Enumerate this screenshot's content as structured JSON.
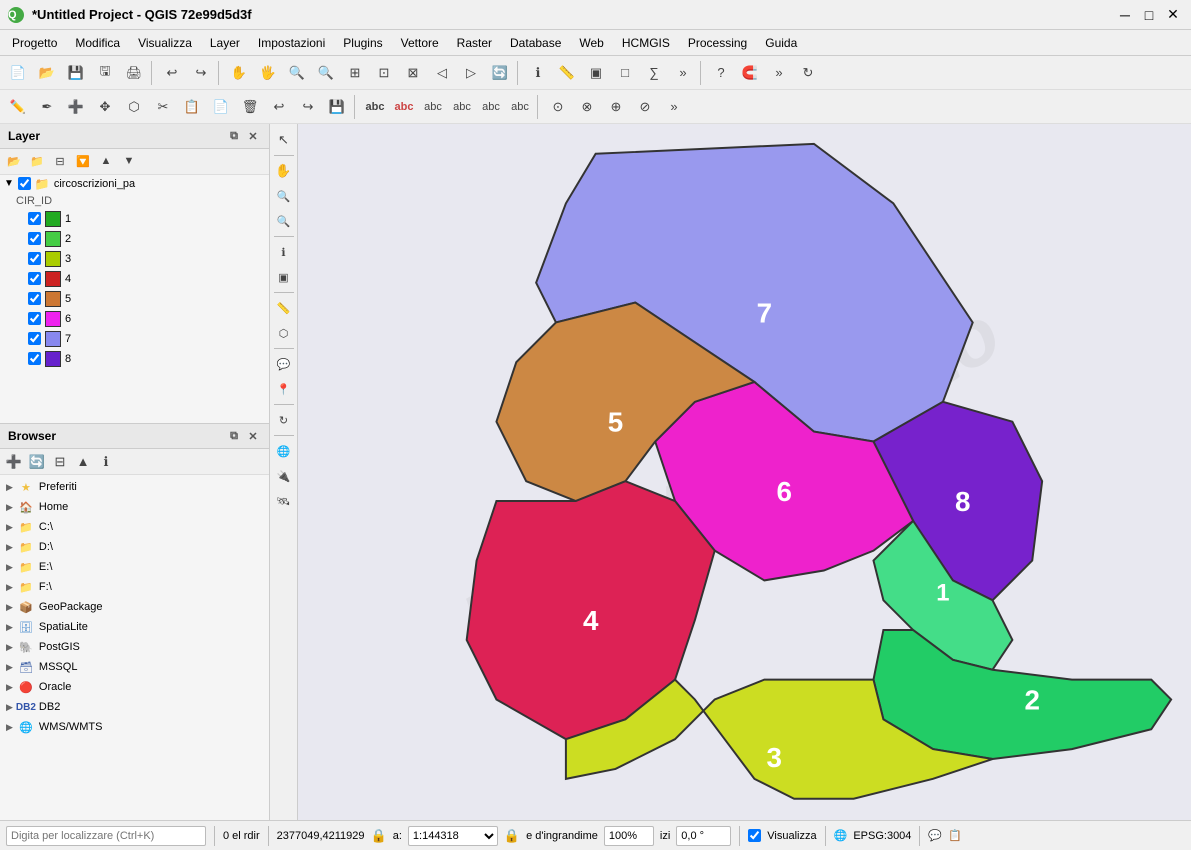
{
  "titlebar": {
    "title": "*Untitled Project - QGIS 72e99d5d3f",
    "icon": "Q"
  },
  "menubar": {
    "items": [
      "Progetto",
      "Modifica",
      "Visualizza",
      "Layer",
      "Impostazioni",
      "Plugins",
      "Vettore",
      "Raster",
      "Database",
      "Web",
      "HCMGIS",
      "Processing",
      "Guida"
    ]
  },
  "layer_panel": {
    "title": "Layer",
    "layer_name": "circoscrizioni_pa",
    "field": "CIR_ID",
    "items": [
      {
        "id": 1,
        "color": "#22aa22",
        "checked": true
      },
      {
        "id": 2,
        "color": "#44cc44",
        "checked": true
      },
      {
        "id": 3,
        "color": "#aacc00",
        "checked": true
      },
      {
        "id": 4,
        "color": "#cc2222",
        "checked": true
      },
      {
        "id": 5,
        "color": "#cc7733",
        "checked": true
      },
      {
        "id": 6,
        "color": "#ee22ee",
        "checked": true
      },
      {
        "id": 7,
        "color": "#8888ee",
        "checked": true
      },
      {
        "id": 8,
        "color": "#6622cc",
        "checked": true
      }
    ]
  },
  "browser_panel": {
    "title": "Browser",
    "items": [
      {
        "label": "Preferiti",
        "icon": "star",
        "type": "favorites"
      },
      {
        "label": "Home",
        "icon": "home",
        "type": "folder"
      },
      {
        "label": "C:\\",
        "icon": "folder",
        "type": "folder"
      },
      {
        "label": "D:\\",
        "icon": "folder",
        "type": "folder"
      },
      {
        "label": "E:\\",
        "icon": "folder",
        "type": "folder"
      },
      {
        "label": "F:\\",
        "icon": "folder",
        "type": "folder"
      },
      {
        "label": "GeoPackage",
        "icon": "geopackage",
        "type": "db"
      },
      {
        "label": "SpatiaLite",
        "icon": "spatialite",
        "type": "db"
      },
      {
        "label": "PostGIS",
        "icon": "postgis",
        "type": "db"
      },
      {
        "label": "MSSQL",
        "icon": "mssql",
        "type": "db"
      },
      {
        "label": "Oracle",
        "icon": "oracle",
        "type": "db"
      },
      {
        "label": "DB2",
        "icon": "db2",
        "type": "db"
      },
      {
        "label": "WMS/WMTS",
        "icon": "wms",
        "type": "service"
      }
    ]
  },
  "map": {
    "regions": [
      {
        "id": 1,
        "label": "1",
        "color": "#44dd88",
        "text_color": "white"
      },
      {
        "id": 2,
        "label": "2",
        "color": "#22cc66",
        "text_color": "white"
      },
      {
        "id": 3,
        "label": "3",
        "color": "#ccdd22",
        "text_color": "white"
      },
      {
        "id": 4,
        "label": "4",
        "color": "#dd2255",
        "text_color": "white"
      },
      {
        "id": 5,
        "label": "5",
        "color": "#cc8844",
        "text_color": "white"
      },
      {
        "id": 6,
        "label": "6",
        "color": "#ee22cc",
        "text_color": "white"
      },
      {
        "id": 7,
        "label": "7",
        "color": "#9999ee",
        "text_color": "white"
      },
      {
        "id": 8,
        "label": "8",
        "color": "#7722cc",
        "text_color": "white"
      }
    ],
    "watermark": "Proge immito"
  },
  "statusbar": {
    "search_placeholder": "Digita per localizzare (Ctrl+K)",
    "elements": "0 el",
    "direction": "rdir",
    "coordinates": "2377049,4211929",
    "scale_label": "a:",
    "scale": "1:144318",
    "zoom_label": "e d'ingrandime",
    "zoom": "100%",
    "rotation_label": "izi",
    "rotation": "0,0 °",
    "visualizza": "Visualizza",
    "epsg": "EPSG:3004"
  }
}
